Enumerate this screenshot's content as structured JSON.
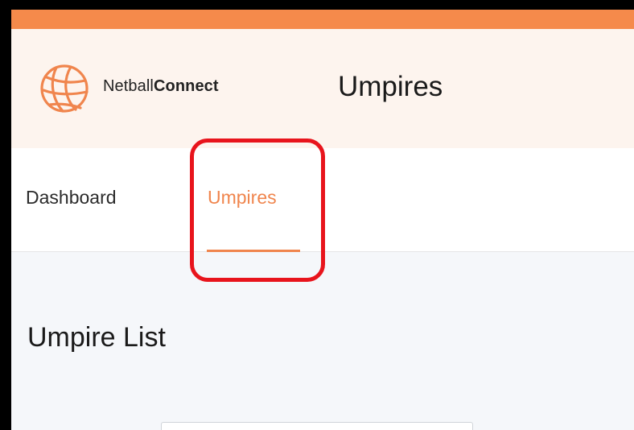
{
  "colors": {
    "accent": "#f58a4b",
    "header_bg": "#fdf4ee",
    "active_tab": "#f0854d",
    "highlight": "#e8141c"
  },
  "header": {
    "logo_icon": "netball-icon",
    "brand_light": "Netball",
    "brand_bold": "Connect",
    "title": "Umpires"
  },
  "nav": {
    "tabs": [
      {
        "label": "Dashboard",
        "active": false
      },
      {
        "label": "Umpires",
        "active": true
      }
    ]
  },
  "main": {
    "section_title": "Umpire List"
  }
}
